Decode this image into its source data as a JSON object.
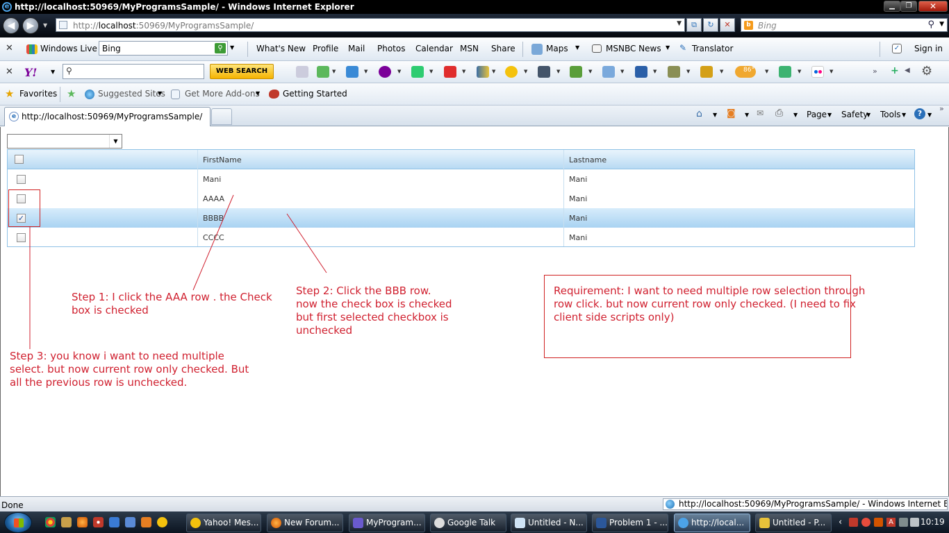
{
  "window": {
    "title": "http://localhost:50969/MyProgramsSample/ - Windows Internet Explorer",
    "min_label": "▁",
    "max_label": "❐",
    "close_label": "✕"
  },
  "nav": {
    "url_prefix": "http://",
    "url_host": "localhost",
    "url_rest": ":50969/MyProgramsSample/",
    "search_placeholder": "Bing"
  },
  "live_toolbar": {
    "close": "✕",
    "brand": "Windows Live",
    "search_value": "Bing",
    "links": [
      "What's New",
      "Profile",
      "Mail",
      "Photos",
      "Calendar",
      "MSN",
      "Share"
    ],
    "maps": "Maps",
    "msnbc": "MSNBC News",
    "translator": "Translator",
    "signin": "Sign in"
  },
  "yahoo_toolbar": {
    "close": "✕",
    "logo": "Y!",
    "search_button": "WEB SEARCH",
    "weather_badge": "86°"
  },
  "fav_toolbar": {
    "favorites": "Favorites",
    "suggested": "Suggested Sites",
    "addons": "Get More Add-ons",
    "getting_started": "Getting Started"
  },
  "tabs": {
    "active_title": "http://localhost:50969/MyProgramsSample/",
    "page_menu": "Page",
    "safety_menu": "Safety",
    "tools_menu": "Tools",
    "help_icon": "?",
    "overflow": "»"
  },
  "grid": {
    "columns": [
      "",
      "FirstName",
      "Lastname"
    ],
    "rows": [
      {
        "first": "Mani",
        "last": "Mani",
        "checked": false
      },
      {
        "first": "AAAA",
        "last": "Mani",
        "checked": false
      },
      {
        "first": "BBBB",
        "last": "Mani",
        "checked": true
      },
      {
        "first": "CCCC",
        "last": "Mani",
        "checked": false
      }
    ],
    "selected_row": 2
  },
  "annotations": {
    "step1": [
      "Step 1: I click the AAA row . the Check",
      "box is checked"
    ],
    "step2": [
      "Step 2: Click the BBB row.",
      "now the check box is checked",
      "but first selected checkbox is",
      "unchecked"
    ],
    "step3": [
      "Step 3: you know i want to need multiple",
      "select. but now current row only checked. But",
      "all the previous row is unchecked."
    ],
    "requirement": [
      "Requirement: I want to need multiple row selection through",
      "row click. but now current row only checked. (I need to fix",
      "client side scripts only)"
    ],
    "color": "#d0202f"
  },
  "status": {
    "text": "Done",
    "url": "http://localhost:50969/MyProgramsSample/ - Windows Internet Explorer"
  },
  "taskbar": {
    "tasks": [
      "Yahoo! Mes...",
      "New Forum...",
      "MyProgram...",
      "Google Talk",
      "Untitled - N...",
      "Problem 1 - ...",
      "http://local...",
      "Untitled - P..."
    ],
    "active_index": 6,
    "clock": "10:19",
    "tray_chevron": "‹"
  }
}
